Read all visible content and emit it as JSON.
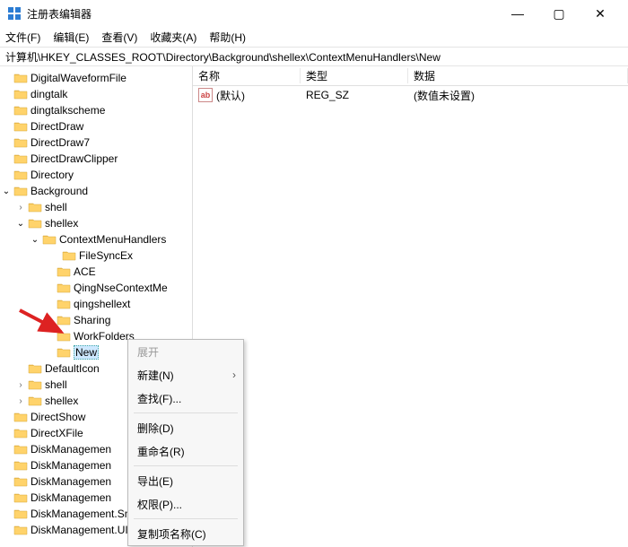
{
  "window": {
    "title": "注册表编辑器",
    "controls": {
      "min": "—",
      "max": "▢",
      "close": "✕"
    }
  },
  "menu": {
    "file": "文件(F)",
    "edit": "编辑(E)",
    "view": "查看(V)",
    "fav": "收藏夹(A)",
    "help": "帮助(H)"
  },
  "address": "计算机\\HKEY_CLASSES_ROOT\\Directory\\Background\\shellex\\ContextMenuHandlers\\New",
  "headers": {
    "name": "名称",
    "type": "类型",
    "data": "数据"
  },
  "row": {
    "icon": "ab",
    "name": "(默认)",
    "type": "REG_SZ",
    "data": "(数值未设置)"
  },
  "tree_labels": {
    "t0": "DigitalWaveformFile",
    "t1": "dingtalk",
    "t2": "dingtalkscheme",
    "t3": "DirectDraw",
    "t4": "DirectDraw7",
    "t5": "DirectDrawClipper",
    "t6": "Directory",
    "t7": "Background",
    "t8": "shell",
    "t9": "shellex",
    "t10": "ContextMenuHandlers",
    "t11": "FileSyncEx",
    "t12": "ACE",
    "t13": "QingNseContextMe",
    "t14": "qingshellext",
    "t15": "Sharing",
    "t16": "WorkFolders",
    "t17": "New",
    "t18": "DefaultIcon",
    "t19": "shell",
    "t20": "shellex",
    "t21": "DirectShow",
    "t22": "DirectXFile",
    "t23": "DiskManagemen",
    "t24": "DiskManagemen",
    "t25": "DiskManagement.SnapInExtens",
    "t26": "DiskManagement.UITasks"
  },
  "ctx": {
    "expand": "展开",
    "new": "新建(N)",
    "find": "查找(F)...",
    "delete": "删除(D)",
    "rename": "重命名(R)",
    "export": "导出(E)",
    "perm": "权限(P)...",
    "copykey": "复制项名称(C)"
  }
}
